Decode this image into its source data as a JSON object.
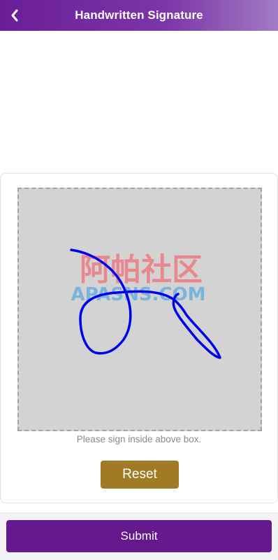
{
  "header": {
    "title": "Handwritten Signature",
    "back_icon": "chevron-left-icon"
  },
  "signature": {
    "hint": "Please sign inside above box.",
    "watermark_line1": "阿帕社区",
    "watermark_line2": "APASNS.COM",
    "stroke_color": "#0000ee",
    "pad_color": "#d3d3d3"
  },
  "actions": {
    "reset_label": "Reset",
    "submit_label": "Submit"
  },
  "colors": {
    "header_purple": "#6a1d97",
    "reset_gold": "#a07a25",
    "submit_purple": "#66198c"
  }
}
